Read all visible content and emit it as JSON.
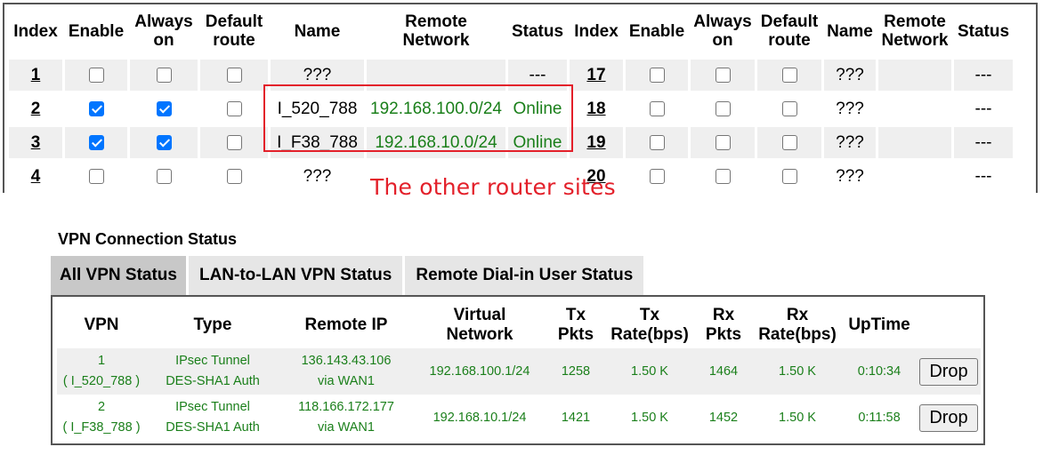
{
  "profile_table": {
    "headers": [
      "Index",
      "Enable",
      "Always on",
      "Default route",
      "Name",
      "Remote Network",
      "Status",
      "Index",
      "Enable",
      "Always on",
      "Default route",
      "Name",
      "Remote Network",
      "Status"
    ],
    "header_lines": [
      [
        "Index"
      ],
      [
        "Enable"
      ],
      [
        "Always",
        "on"
      ],
      [
        "Default",
        "route"
      ],
      [
        "Name"
      ],
      [
        "Remote",
        "Network"
      ],
      [
        "Status"
      ],
      [
        "Index"
      ],
      [
        "Enable"
      ],
      [
        "Always",
        "on"
      ],
      [
        "Default",
        "route"
      ],
      [
        "Name"
      ],
      [
        "Remote",
        "Network"
      ],
      [
        "Status"
      ]
    ],
    "rows": [
      {
        "left": {
          "index": "1",
          "enable": false,
          "always_on": false,
          "default_route": false,
          "name": "???",
          "remote_network": "",
          "status": "---"
        },
        "right": {
          "index": "17",
          "enable": false,
          "always_on": false,
          "default_route": false,
          "name": "???",
          "remote_network": "",
          "status": "---"
        }
      },
      {
        "left": {
          "index": "2",
          "enable": true,
          "always_on": true,
          "default_route": false,
          "name": "I_520_788",
          "remote_network": "192.168.100.0/24",
          "status": "Online"
        },
        "right": {
          "index": "18",
          "enable": false,
          "always_on": false,
          "default_route": false,
          "name": "???",
          "remote_network": "",
          "status": "---"
        }
      },
      {
        "left": {
          "index": "3",
          "enable": true,
          "always_on": true,
          "default_route": false,
          "name": "I_F38_788",
          "remote_network": "192.168.10.0/24",
          "status": "Online"
        },
        "right": {
          "index": "19",
          "enable": false,
          "always_on": false,
          "default_route": false,
          "name": "???",
          "remote_network": "",
          "status": "---"
        }
      },
      {
        "left": {
          "index": "4",
          "enable": false,
          "always_on": false,
          "default_route": false,
          "name": "???",
          "remote_network": "",
          "status": ""
        },
        "right": {
          "index": "20",
          "enable": false,
          "always_on": false,
          "default_route": false,
          "name": "???",
          "remote_network": "",
          "status": "---"
        }
      }
    ]
  },
  "annotation": {
    "text": "The other router sites",
    "color": "#e3202a"
  },
  "vpn_status": {
    "title": "VPN Connection Status",
    "tabs": [
      {
        "label": "All VPN Status",
        "active": true
      },
      {
        "label": "LAN-to-LAN VPN Status",
        "active": false
      },
      {
        "label": "Remote Dial-in User Status",
        "active": false
      }
    ],
    "headers": [
      [
        "VPN"
      ],
      [
        "Type"
      ],
      [
        "Remote IP"
      ],
      [
        "Virtual",
        "Network"
      ],
      [
        "Tx",
        "Pkts"
      ],
      [
        "Tx",
        "Rate(bps)"
      ],
      [
        "Rx",
        "Pkts"
      ],
      [
        "Rx",
        "Rate(bps)"
      ],
      [
        "UpTime"
      ],
      [
        ""
      ]
    ],
    "rows": [
      {
        "vpn_index": "1",
        "vpn_name": "( I_520_788 )",
        "type_line1": "IPsec Tunnel",
        "type_line2": "DES-SHA1 Auth",
        "remote_ip": "136.143.43.106",
        "remote_via": "via WAN1",
        "virtual_network": "192.168.100.1/24",
        "tx_pkts": "1258",
        "tx_rate": "1.50 K",
        "rx_pkts": "1464",
        "rx_rate": "1.50 K",
        "uptime": "0:10:34",
        "action": "Drop"
      },
      {
        "vpn_index": "2",
        "vpn_name": "( I_F38_788 )",
        "type_line1": "IPsec Tunnel",
        "type_line2": "DES-SHA1 Auth",
        "remote_ip": "118.166.172.177",
        "remote_via": "via WAN1",
        "virtual_network": "192.168.10.1/24",
        "tx_pkts": "1421",
        "tx_rate": "1.50 K",
        "rx_pkts": "1452",
        "rx_rate": "1.50 K",
        "uptime": "0:11:58",
        "action": "Drop"
      }
    ],
    "status_color": "#1a7f1a"
  }
}
